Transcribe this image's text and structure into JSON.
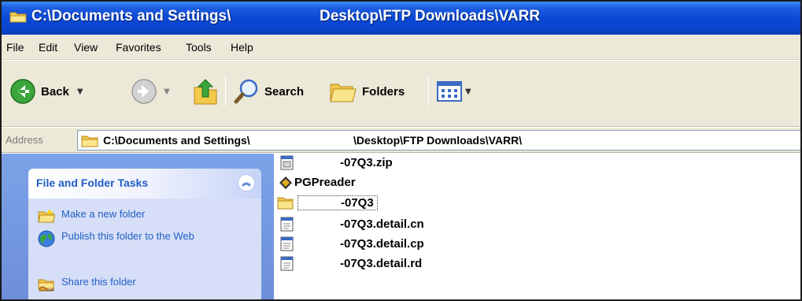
{
  "window": {
    "title_part1": "C:\\Documents and Settings\\",
    "title_part2": "Desktop\\FTP Downloads\\VARR"
  },
  "menu": {
    "items": [
      "File",
      "Edit",
      "View",
      "Favorites",
      "Tools",
      "Help"
    ]
  },
  "toolbar": {
    "back_label": "Back",
    "search_label": "Search",
    "folders_label": "Folders"
  },
  "address": {
    "label": "Address",
    "path_part1": "C:\\Documents and Settings\\",
    "path_part2": "\\Desktop\\FTP Downloads\\VARR\\"
  },
  "task_pane": {
    "title": "File and Folder Tasks",
    "tasks": [
      {
        "label": "Make a new folder",
        "icon": "new-folder-icon"
      },
      {
        "label": "Publish this folder to the Web",
        "icon": "globe-icon"
      },
      {
        "label": "Share this folder",
        "icon": "share-folder-icon"
      }
    ]
  },
  "files": [
    {
      "name": "-07Q3.zip",
      "icon": "zip-file-icon"
    },
    {
      "name": "PGPreader",
      "icon": "executable-icon"
    },
    {
      "name": "-07Q3",
      "icon": "folder-icon",
      "selected": true
    },
    {
      "name": "-07Q3.detail.cn",
      "icon": "document-icon"
    },
    {
      "name": "-07Q3.detail.cp",
      "icon": "document-icon"
    },
    {
      "name": "-07Q3.detail.rd",
      "icon": "document-icon"
    }
  ],
  "colors": {
    "titlebar": "#0a49d6",
    "chrome": "#ece9d8",
    "task_pane_bg": "#7ba2e7",
    "task_link": "#215dc6"
  }
}
